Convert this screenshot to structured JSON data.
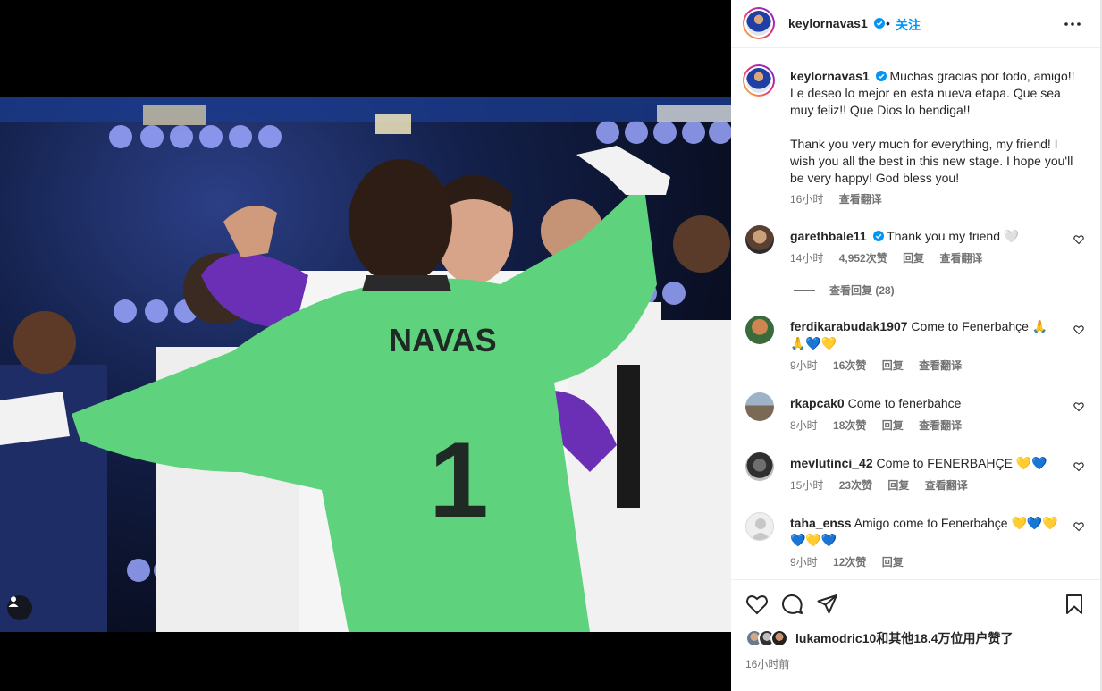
{
  "post": {
    "author": "keylornavas1",
    "follow_label": "关注",
    "separator": "•",
    "time_ago": "16小时前"
  },
  "caption": {
    "username": "keylornavas1",
    "text_es": "Muchas gracias por todo, amigo!! Le deseo lo mejor en esta nueva etapa. Que sea muy feliz!! Que Dios lo bendiga!!",
    "text_en": "Thank you very much for everything, my friend! I wish you all the best in this new stage. I hope you'll be very happy! God bless you!",
    "time": "16小时",
    "translate": "查看翻译"
  },
  "comments": [
    {
      "username": "garethbale11",
      "verified": true,
      "text": "Thank you my friend 🤍",
      "time": "14小时",
      "likes": "4,952次赞",
      "reply": "回复",
      "translate": "查看翻译"
    },
    {
      "username": "ferdikarabudak1907",
      "verified": false,
      "text": "Come to Fenerbahçe 🙏🙏💙💛",
      "time": "9小时",
      "likes": "16次赞",
      "reply": "回复",
      "translate": "查看翻译"
    },
    {
      "username": "rkapcak0",
      "verified": false,
      "text": "Come to fenerbahce",
      "time": "8小时",
      "likes": "18次赞",
      "reply": "回复",
      "translate": "查看翻译"
    },
    {
      "username": "mevlutinci_42",
      "verified": false,
      "text": "Come to FENERBAHÇE 💛💙",
      "time": "15小时",
      "likes": "23次赞",
      "reply": "回复",
      "translate": "查看翻译"
    },
    {
      "username": "taha_enss",
      "verified": false,
      "text": "Amigo come to Fenerbahçe 💛💙💛💙💛💙",
      "time": "9小时",
      "likes": "12次赞",
      "reply": "回复"
    }
  ],
  "view_replies": "查看回复 (28)",
  "likes": {
    "user": "lukamodric10",
    "rest": "和其他18.4万位用户赞了"
  },
  "photo": {
    "jersey_name": "NAVAS",
    "jersey_number": "1"
  },
  "colors": {
    "accent": "#0095f6",
    "verified": "#0095f6",
    "jersey": "#5fd27d",
    "text": "#262626",
    "muted": "#737373"
  },
  "icons": [
    "user-tag-icon",
    "verified-icon",
    "more-options-icon",
    "heart-icon",
    "comment-icon",
    "share-icon",
    "bookmark-icon"
  ]
}
